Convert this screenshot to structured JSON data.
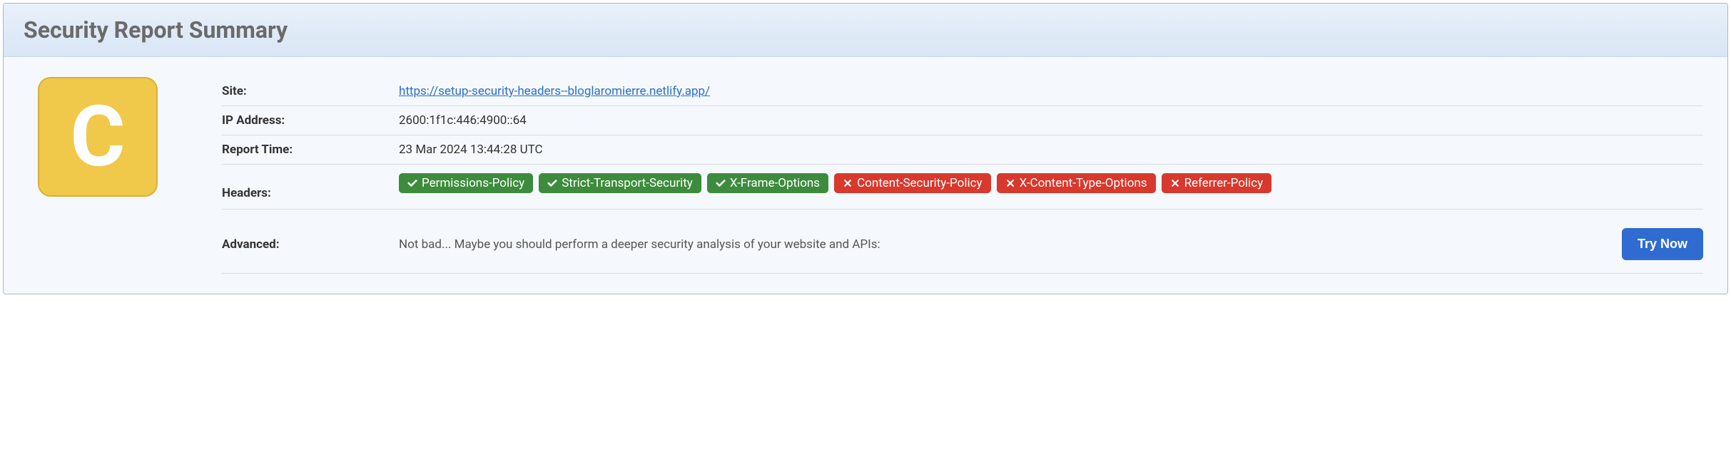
{
  "title": "Security Report Summary",
  "grade": "C",
  "rows": {
    "site": {
      "label": "Site:",
      "value": "https://setup-security-headers--bloglaromierre.netlify.app/"
    },
    "ip": {
      "label": "IP Address:",
      "value": "2600:1f1c:446:4900::64"
    },
    "time": {
      "label": "Report Time:",
      "value": "23 Mar 2024 13:44:28 UTC"
    },
    "headers": {
      "label": "Headers:",
      "items": [
        {
          "name": "Permissions-Policy",
          "pass": true
        },
        {
          "name": "Strict-Transport-Security",
          "pass": true
        },
        {
          "name": "X-Frame-Options",
          "pass": true
        },
        {
          "name": "Content-Security-Policy",
          "pass": false
        },
        {
          "name": "X-Content-Type-Options",
          "pass": false
        },
        {
          "name": "Referrer-Policy",
          "pass": false
        }
      ]
    },
    "advanced": {
      "label": "Advanced:",
      "text": "Not bad... Maybe you should perform a deeper security analysis of your website and APIs:",
      "button": "Try Now"
    }
  }
}
